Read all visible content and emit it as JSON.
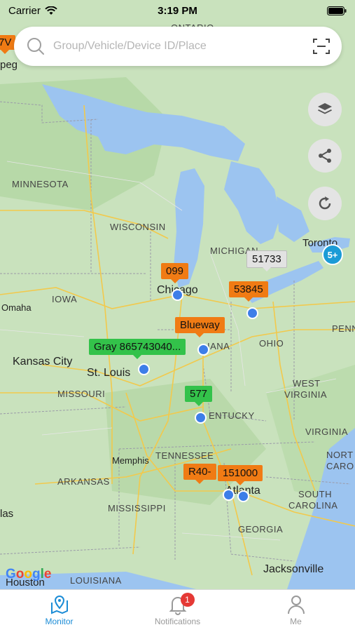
{
  "status_bar": {
    "carrier": "Carrier",
    "time": "3:19 PM"
  },
  "search": {
    "placeholder": "Group/Vehicle/Device ID/Place"
  },
  "map_labels": {
    "ontario": "ONTARIO",
    "peg": "peg",
    "minnesota": "MINNESOTA",
    "wisconsin": "WISCONSIN",
    "michigan": "MICHIGAN",
    "iowa": "IOWA",
    "omaha": "Omaha",
    "chicago": "Chicago",
    "toronto": "Toronto",
    "kansas_city": "Kansas City",
    "st_louis": "St. Louis",
    "missouri": "MISSOURI",
    "indiana": "IANA",
    "ohio": "OHIO",
    "penn": "PENN",
    "west_virginia_1": "WEST",
    "west_virginia_2": "VIRGINIA",
    "virginia": "VIRGINIA",
    "kentucky": "ENTUCKY",
    "tennessee": "TENNESSEE",
    "memphis": "Memphis",
    "arkansas": "ARKANSAS",
    "north_carolina_1": "NORT",
    "north_carolina_2": "CARO",
    "south_carolina_1": "SOUTH",
    "south_carolina_2": "CAROLINA",
    "atlanta": "Atlanta",
    "mississippi": "MISSISSIPPI",
    "georgia": "GEORGIA",
    "las": "las",
    "louisiana": "LOUISIANA",
    "houston": "Houston",
    "jacksonville": "Jacksonville",
    "v7": "7V",
    "google": "Google"
  },
  "vehicle_labels": [
    {
      "text": "099",
      "color": "orange"
    },
    {
      "text": "51733",
      "color": "gray"
    },
    {
      "text": "53845",
      "color": "orange"
    },
    {
      "text": "Blueway",
      "color": "orange"
    },
    {
      "text": "Gray 865743040...",
      "color": "green"
    },
    {
      "text": "577",
      "color": "green"
    },
    {
      "text": "R40-",
      "color": "orange"
    },
    {
      "text": "151000",
      "color": "orange"
    }
  ],
  "cluster": {
    "count": "5+"
  },
  "tabs": [
    {
      "label": "Monitor",
      "active": true
    },
    {
      "label": "Notifications",
      "badge": "1"
    },
    {
      "label": "Me"
    }
  ],
  "colors": {
    "accent": "#1b8cd6",
    "orange": "#f07b14",
    "green": "#33c24a",
    "marker": "#3d7ee8",
    "badge": "#e53935"
  }
}
